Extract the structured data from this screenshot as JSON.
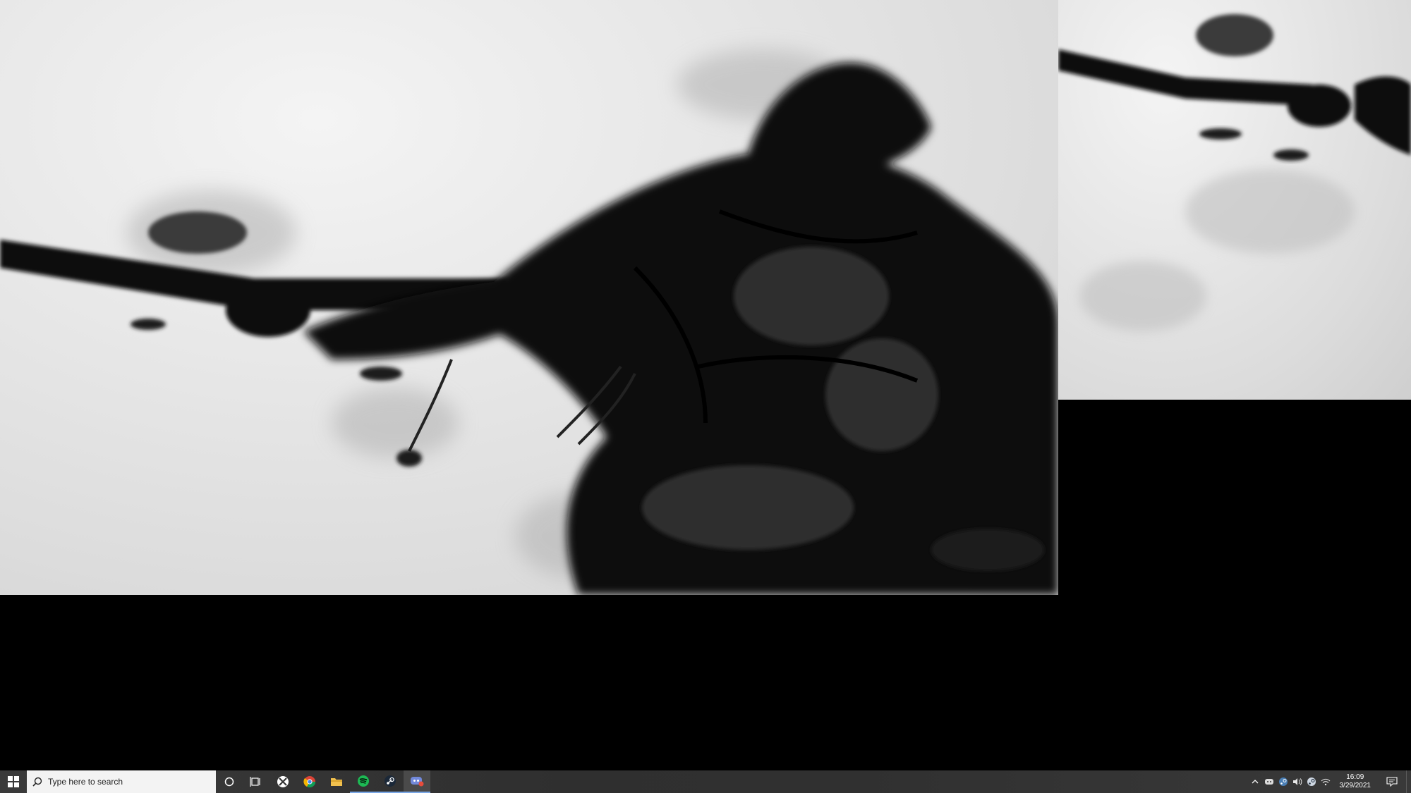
{
  "taskbar": {
    "search_placeholder": "Type here to search",
    "pinned": [
      {
        "id": "cortana",
        "icon": "circle-icon"
      },
      {
        "id": "task-view",
        "icon": "task-view-icon"
      },
      {
        "id": "xbox",
        "icon": "xbox-icon"
      },
      {
        "id": "chrome",
        "icon": "chrome-icon"
      },
      {
        "id": "file-explorer",
        "icon": "folder-icon"
      },
      {
        "id": "spotify",
        "icon": "spotify-icon"
      },
      {
        "id": "steam",
        "icon": "steam-icon"
      },
      {
        "id": "discord-app",
        "icon": "discord-icon"
      }
    ],
    "clock": {
      "time": "16:09",
      "date": "3/29/2021"
    }
  },
  "colors": {
    "taskbar_bg": "#333333",
    "accent_underline": "#7aa7e6",
    "search_bg": "#f3f3f3",
    "spotify_green": "#1db954",
    "chrome_red": "#db4437",
    "chrome_yellow": "#f4b400",
    "chrome_green": "#0f9d58",
    "chrome_blue": "#4285f4",
    "folder_yellow": "#f2c14e",
    "steam_blue": "#1b2838"
  }
}
